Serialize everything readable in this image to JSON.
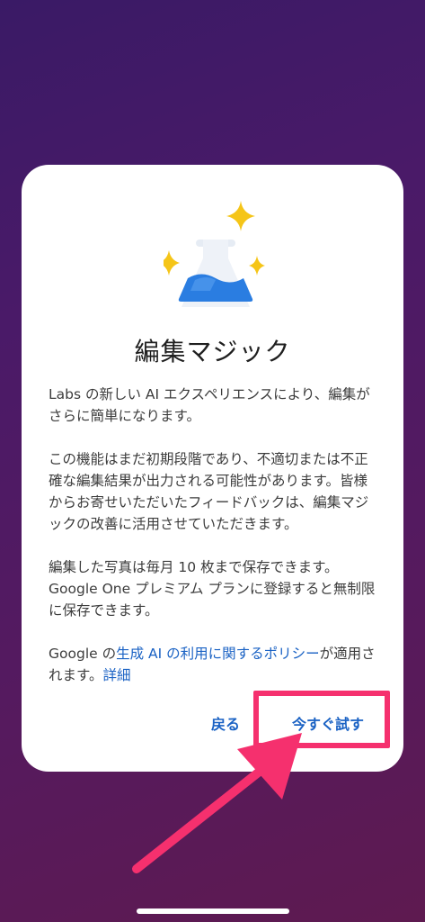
{
  "dialog": {
    "illustration_icon": "lab-flask-sparkles-icon",
    "title": "編集マジック",
    "paragraph1": "Labs の新しい AI エクスペリエンスにより、編集がさらに簡単になります。",
    "paragraph2": "この機能はまだ初期段階であり、不適切または不正確な編集結果が出力される可能性があります。皆様からお寄せいただいたフィードバックは、編集マジックの改善に活用させていただきます。",
    "paragraph3": "編集した写真は毎月 10 枚まで保存できます。Google One プレミアム プランに登録すると無制限に保存できます。",
    "policy_prefix": "Google の",
    "policy_link": "生成 AI の利用に関するポリシー",
    "policy_suffix": "が適用されます。",
    "details_link": "詳細",
    "back_label": "戻る",
    "try_now_label": "今すぐ試す"
  },
  "annotation": {
    "highlight_color": "#f5306e",
    "arrow_icon": "pointer-arrow-icon"
  },
  "colors": {
    "accent": "#1a62c4",
    "flask_liquid": "#2a7de1",
    "sparkle": "#f5c518"
  }
}
